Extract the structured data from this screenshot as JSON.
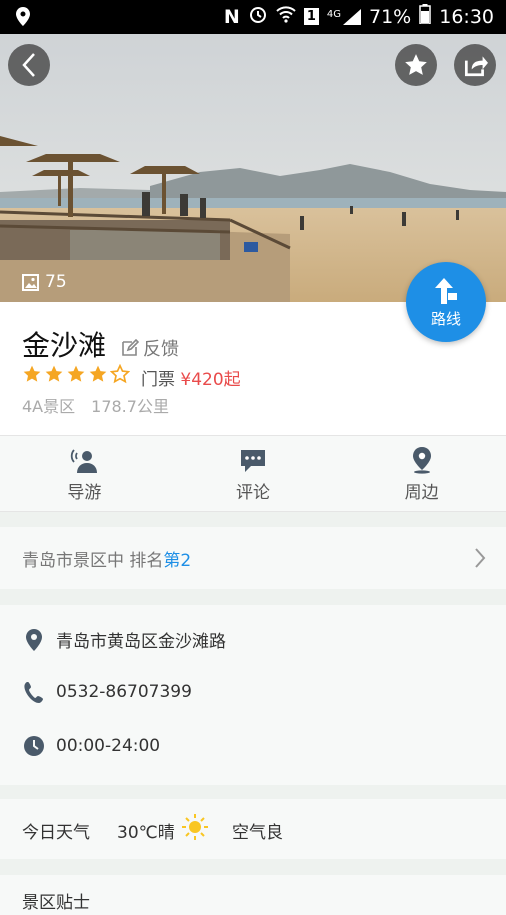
{
  "status_bar": {
    "battery": "71%",
    "time": "16:30",
    "network": "4G"
  },
  "hero": {
    "photo_count": "75"
  },
  "route_button": {
    "label": "路线"
  },
  "spot": {
    "name": "金沙滩",
    "feedback_label": "反馈",
    "rating": 4,
    "rating_max": 5,
    "ticket_label": "门票",
    "ticket_price": "¥420",
    "ticket_suffix": "起",
    "level": "4A景区",
    "distance": "178.7公里"
  },
  "actions": [
    {
      "label": "导游",
      "icon": "guide-icon"
    },
    {
      "label": "评论",
      "icon": "comment-icon"
    },
    {
      "label": "周边",
      "icon": "nearby-icon"
    }
  ],
  "ranking": {
    "prefix": "青岛市景区中  排名",
    "rank": "第2"
  },
  "contact": {
    "address": "青岛市黄岛区金沙滩路",
    "phone": "0532-86707399",
    "hours": "00:00-24:00"
  },
  "weather": {
    "label": "今日天气",
    "temp": "30℃晴",
    "air": "空气良"
  },
  "next_section": {
    "title": "景区贴士"
  },
  "colors": {
    "accent": "#1e8fe6",
    "price": "#e94b4b",
    "star": "#f5a623"
  }
}
